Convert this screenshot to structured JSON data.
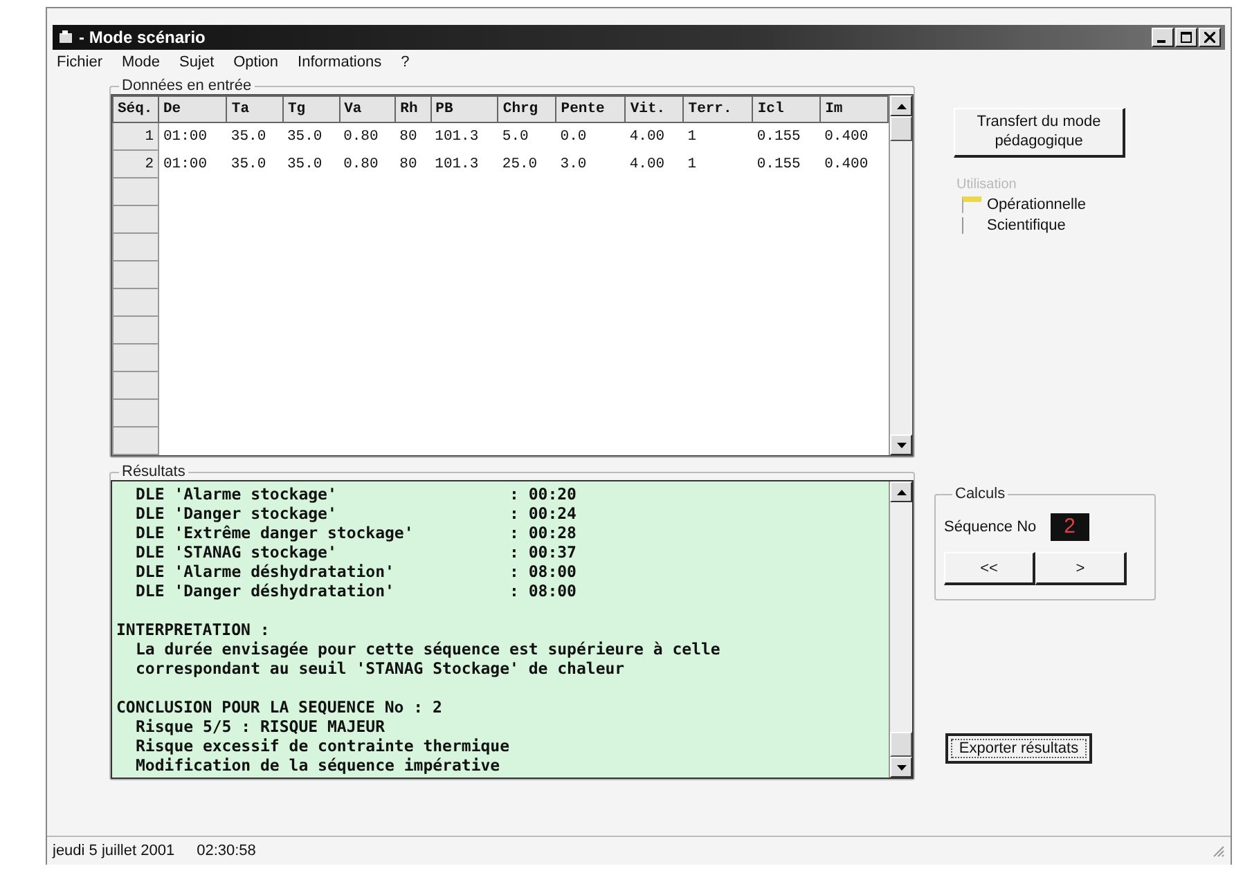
{
  "window": {
    "title": "- Mode scénario"
  },
  "menu": [
    "Fichier",
    "Mode",
    "Sujet",
    "Option",
    "Informations",
    "?"
  ],
  "input": {
    "title": "Données en entrée",
    "columns": [
      "Séq.",
      "De",
      "Ta",
      "Tg",
      "Va",
      "Rh",
      "PB",
      "Chrg",
      "Pente",
      "Vit.",
      "Terr.",
      "Icl",
      "Im"
    ],
    "rows": [
      [
        "1",
        "01:00",
        "35.0",
        "35.0",
        "0.80",
        "80",
        "101.3",
        "5.0",
        "0.0",
        "4.00",
        "1",
        "0.155",
        "0.400"
      ],
      [
        "2",
        "01:00",
        "35.0",
        "35.0",
        "0.80",
        "80",
        "101.3",
        "25.0",
        "3.0",
        "4.00",
        "1",
        "0.155",
        "0.400"
      ]
    ]
  },
  "transfer_button": "Transfert du mode pédagogique",
  "utilisation": {
    "label": "Utilisation",
    "disabled": true,
    "options": [
      {
        "label": "Opérationnelle",
        "selected": true
      },
      {
        "label": "Scientifique",
        "selected": false
      }
    ]
  },
  "results": {
    "title": "Résultats",
    "dle": [
      {
        "label": "DLE 'Alarme stockage'",
        "value": ": 00:20"
      },
      {
        "label": "DLE 'Danger stockage'",
        "value": ": 00:24"
      },
      {
        "label": "DLE 'Extrême danger stockage'",
        "value": ": 00:28"
      },
      {
        "label": "DLE 'STANAG stockage'",
        "value": ": 00:37"
      },
      {
        "label": "DLE 'Alarme déshydratation'",
        "value": ": 08:00"
      },
      {
        "label": "DLE 'Danger déshydratation'",
        "value": ": 08:00"
      }
    ],
    "sections": [
      {
        "heading": "INTERPRETATION :",
        "lines": [
          "La durée envisagée pour cette séquence est supérieure à celle",
          "correspondant au seuil 'STANAG Stockage' de chaleur"
        ]
      },
      {
        "heading": "CONCLUSION POUR LA SEQUENCE No : 2",
        "lines": [
          "Risque 5/5 : RISQUE MAJEUR",
          "Risque excessif de contrainte thermique",
          "Modification de la séquence impérative"
        ]
      }
    ]
  },
  "calculs": {
    "title": "Calculs",
    "label": "Séquence No",
    "value": "2",
    "prev": "<<",
    "next": ">"
  },
  "export_button": "Exporter résultats",
  "status_bar": {
    "date": "jeudi 5 juillet 2001",
    "time": "02:30:58"
  }
}
